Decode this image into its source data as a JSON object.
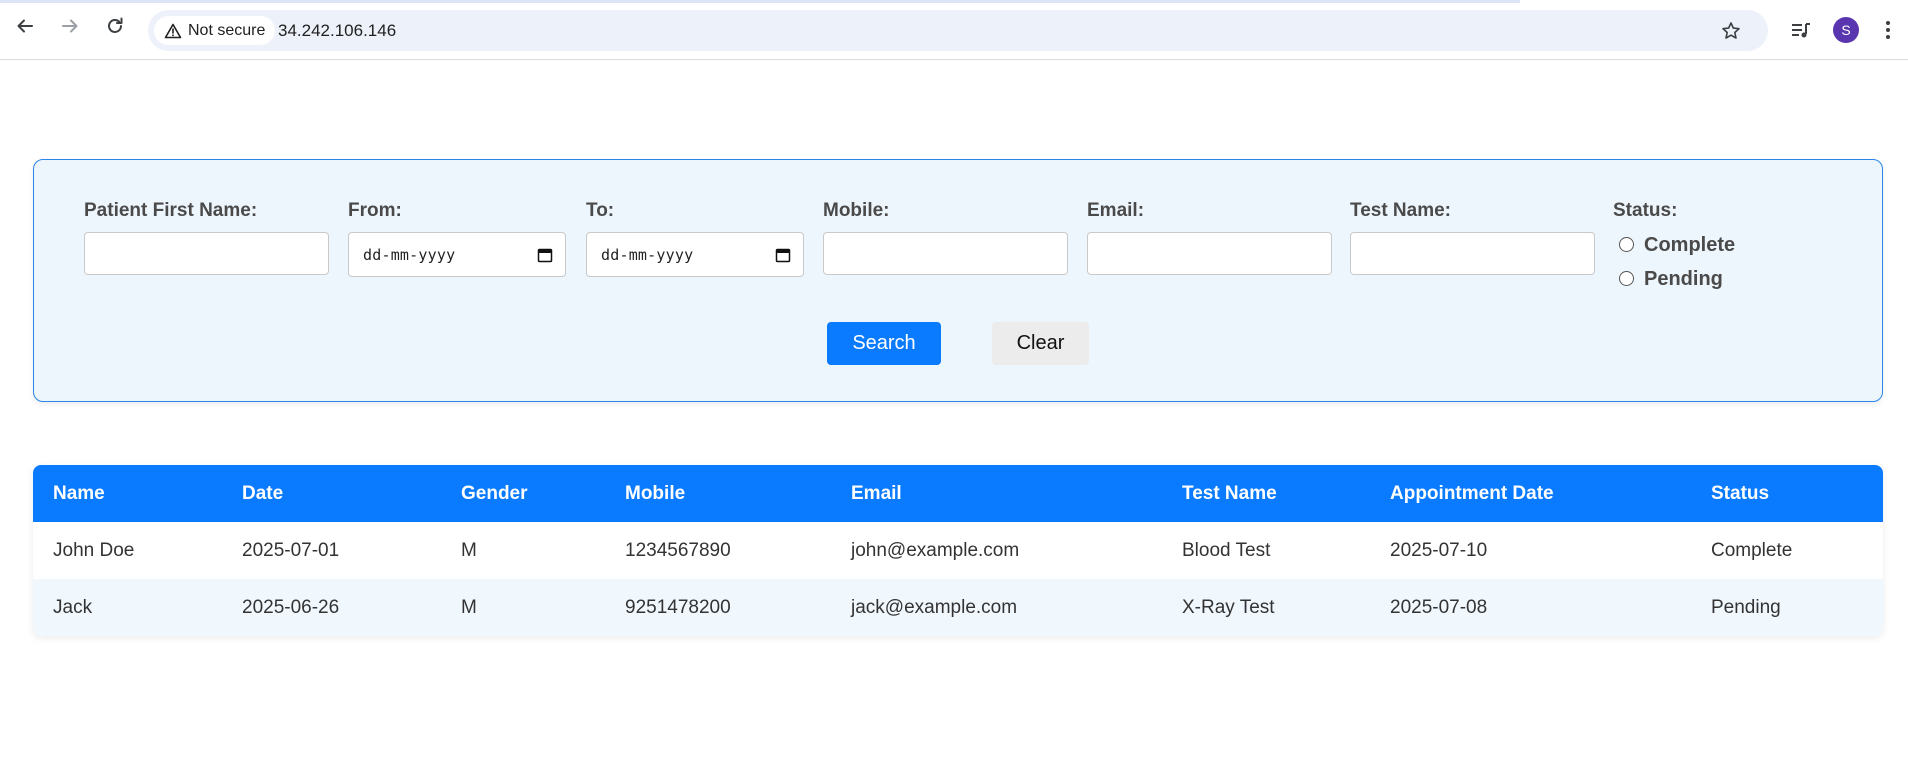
{
  "browser": {
    "security_label": "Not secure",
    "url": "34.242.106.146",
    "profile_initial": "S"
  },
  "filters": {
    "first_name_label": "Patient First Name:",
    "from_label": "From:",
    "from_placeholder": "dd-mm-yyyy",
    "to_label": "To:",
    "to_placeholder": "dd-mm-yyyy",
    "mobile_label": "Mobile:",
    "email_label": "Email:",
    "test_name_label": "Test Name:",
    "status_label": "Status:",
    "status_options": [
      "Complete",
      "Pending"
    ],
    "search_label": "Search",
    "clear_label": "Clear"
  },
  "table": {
    "headers": [
      "Name",
      "Date",
      "Gender",
      "Mobile",
      "Email",
      "Test Name",
      "Appointment Date",
      "Status"
    ],
    "rows": [
      [
        "John Doe",
        "2025-07-01",
        "M",
        "1234567890",
        "john@example.com",
        "Blood Test",
        "2025-07-10",
        "Complete"
      ],
      [
        "Jack",
        "2025-06-26",
        "M",
        "9251478200",
        "jack@example.com",
        "X-Ray Test",
        "2025-07-08",
        "Pending"
      ]
    ]
  },
  "colors": {
    "accent": "#0a7bff",
    "panel_bg": "#eef6fd",
    "panel_border": "#2a86e8",
    "avatar": "#5a35b0"
  }
}
